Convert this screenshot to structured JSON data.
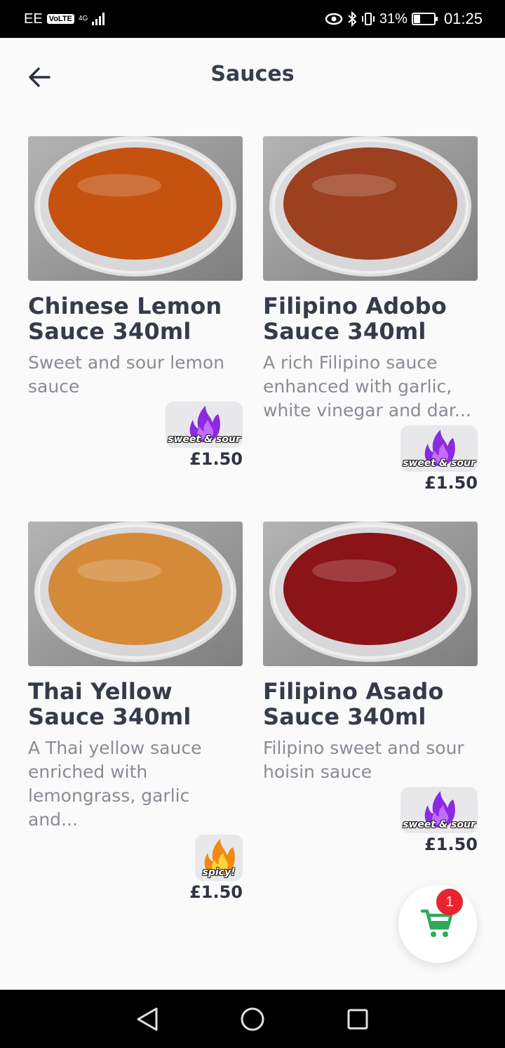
{
  "status_bar": {
    "carrier": "EE",
    "volte": "VoLTE",
    "network": "4G",
    "battery": "31%",
    "battery_level": 0.31,
    "time": "01:25"
  },
  "header": {
    "title": "Sauces"
  },
  "products": [
    {
      "name": "Chinese Lemon Sauce 340ml",
      "description": "Sweet and sour lemon sauce",
      "badge": "sweet & sour",
      "badge_icon": "purple-flame-icon",
      "price": "£1.50",
      "sauce_color": "#c5520f"
    },
    {
      "name": "Filipino Adobo Sauce 340ml",
      "description": "A rich Filipino sauce enhanced with garlic, white vinegar and dar...",
      "badge": "sweet & sour",
      "badge_icon": "purple-flame-icon",
      "price": "£1.50",
      "sauce_color": "#9c4020"
    },
    {
      "name": "Thai Yellow Sauce 340ml",
      "description": "A Thai yellow sauce enriched with lemongrass, garlic and...",
      "badge": "spicy!",
      "badge_icon": "orange-flame-icon",
      "price": "£1.50",
      "sauce_color": "#d58a3a"
    },
    {
      "name": "Filipino Asado Sauce 340ml",
      "description": "Filipino sweet and sour hoisin sauce",
      "badge": "sweet & sour",
      "badge_icon": "purple-flame-icon",
      "price": "£1.50",
      "sauce_color": "#8a1418"
    }
  ],
  "cart": {
    "count": "1",
    "icon": "shopping-cart-icon",
    "color": "#2ea85a",
    "badge_color": "#e8242e"
  },
  "nav": {
    "back_icon": "nav-back-icon",
    "home_icon": "nav-home-icon",
    "recents_icon": "nav-recents-icon"
  }
}
